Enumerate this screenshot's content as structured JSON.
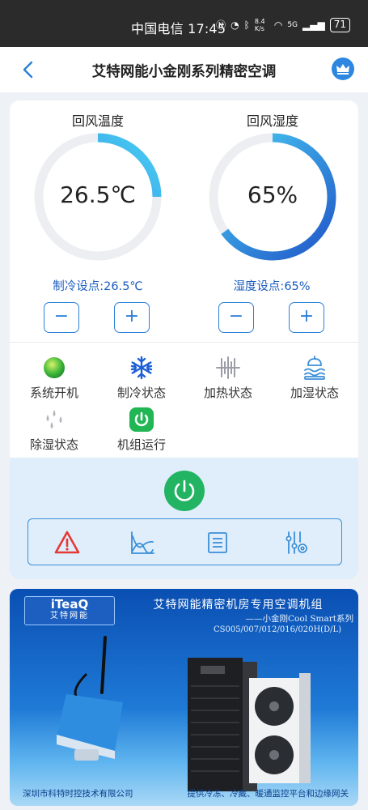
{
  "status_bar": {
    "carrier_time": "中国电信 17:45",
    "speed": "8.4 K/s",
    "signal": "5G",
    "battery": "71"
  },
  "nav": {
    "title": "艾特网能小金刚系列精密空调"
  },
  "return_temp": {
    "title": "回风温度",
    "value": "26.5℃",
    "level": 0.25,
    "setpoint_label": "制冷设点:26.5℃",
    "minus": "−",
    "plus": "+"
  },
  "return_humidity": {
    "title": "回风湿度",
    "value": "65%",
    "level": 0.65,
    "setpoint_label": "湿度设点:65%",
    "minus": "−",
    "plus": "+"
  },
  "status_items": [
    {
      "label": "系统开机",
      "icon": "green-ball-icon"
    },
    {
      "label": "制冷状态",
      "icon": "snowflake-icon"
    },
    {
      "label": "加热状态",
      "icon": "heater-icon"
    },
    {
      "label": "加湿状态",
      "icon": "humidifier-icon"
    },
    {
      "label": "除湿状态",
      "icon": "droplets-icon"
    },
    {
      "label": "机组运行",
      "icon": "power-icon"
    }
  ],
  "toolbar": [
    "alarm-icon",
    "trend-chart-icon",
    "list-icon",
    "settings-sliders-icon"
  ],
  "banner": {
    "logo": "iTeaQ",
    "logo_sub": "艾特网能",
    "title": "艾特网能精密机房专用空调机组",
    "subtitle": "——小金刚Cool Smart系列",
    "models": "CS005/007/012/016/020H(D/L)",
    "footer_left": "深圳市科特时控技术有限公司",
    "footer_right": "提供冷冻、冷藏、暖通监控平台和边缘网关"
  },
  "colors": {
    "accent_blue": "#2b7fd8",
    "setpoint_text": "#1a5cc0",
    "running_green": "#22b463",
    "alarm_red": "#e53935"
  }
}
